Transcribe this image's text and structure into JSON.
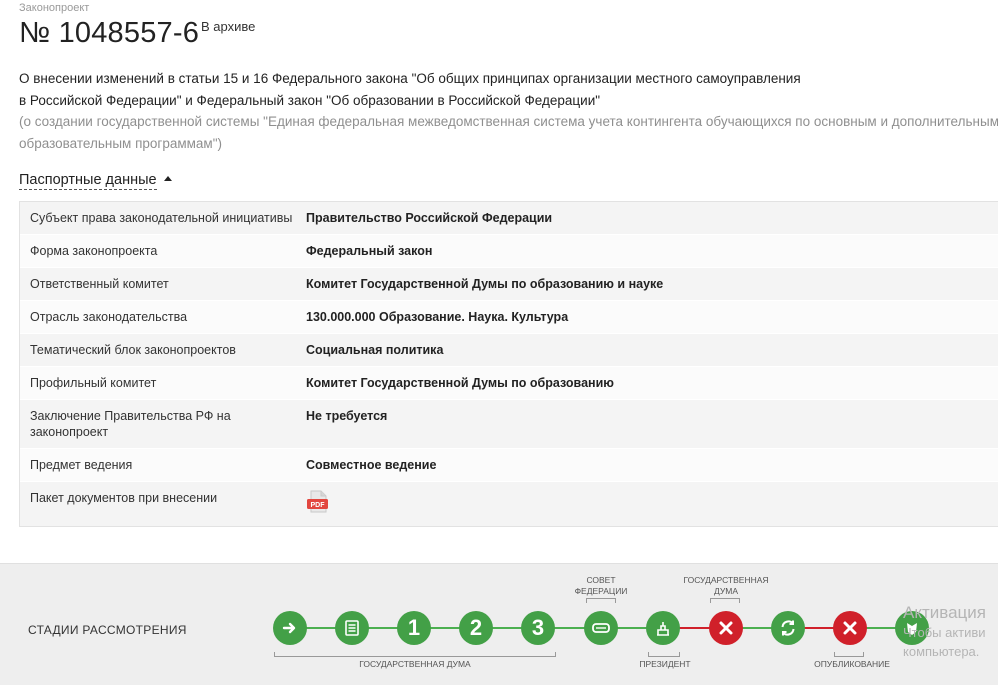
{
  "breadcrumb": "Законопроект",
  "bill": {
    "number": "№ 1048557-6",
    "status": "В архиве",
    "title_line1": "О внесении изменений в статьи 15 и 16 Федерального закона \"Об общих принципах организации местного самоуправления",
    "title_line2": "в Российской Федерации\" и Федеральный закон \"Об образовании в Российской Федерации\"",
    "subtitle_line1": "(о создании государственной системы \"Единая федеральная межведомственная система учета контингента обучающихся по основным и дополнительным",
    "subtitle_line2": "образовательным программам\")"
  },
  "passport": {
    "toggle_label": "Паспортные данные",
    "rows": [
      {
        "label": "Субъект права законодательной инициативы",
        "value": "Правительство Российской Федерации"
      },
      {
        "label": "Форма законопроекта",
        "value": "Федеральный закон"
      },
      {
        "label": "Ответственный комитет",
        "value": "Комитет Государственной Думы по образованию и науке"
      },
      {
        "label": "Отрасль законодательства",
        "value": "130.000.000 Образование. Наука. Культура"
      },
      {
        "label": "Тематический блок законопроектов",
        "value": "Социальная политика"
      },
      {
        "label": "Профильный комитет",
        "value": "Комитет Государственной Думы по образованию"
      },
      {
        "label": "Заключение Правительства РФ на законопроект",
        "value": "Не требуется"
      },
      {
        "label": "Предмет ведения",
        "value": "Совместное ведение"
      },
      {
        "label": "Пакет документов при внесении",
        "value": ""
      }
    ],
    "pdf_label": "PDF"
  },
  "stages": {
    "label": "СТАДИИ РАССМОТРЕНИЯ",
    "nums": [
      "1",
      "2",
      "3"
    ],
    "caption_council": "СОВЕТ ФЕДЕРАЦИИ",
    "caption_duma_top": "ГОСУДАРСТВЕННАЯ ДУМА",
    "caption_duma_bottom": "ГОСУДАРСТВЕННАЯ ДУМА",
    "caption_president": "ПРЕЗИДЕНТ",
    "caption_published": "ОПУБЛИКОВАНИЕ",
    "colors": {
      "green": "#43a047",
      "red": "#d0202a"
    }
  },
  "watermark": {
    "line1": "Активация",
    "line2": "Чтобы активи",
    "line3": "компьютера."
  }
}
